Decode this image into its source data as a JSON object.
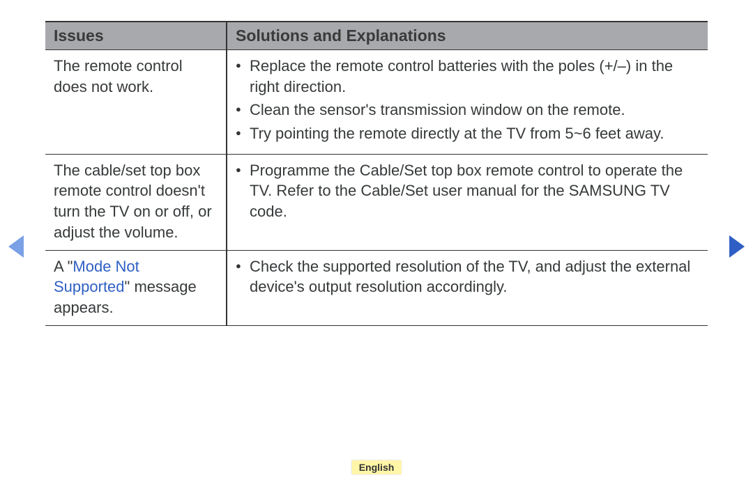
{
  "headers": {
    "issues": "Issues",
    "solutions": "Solutions and Explanations"
  },
  "rows": [
    {
      "issue_parts": [
        {
          "text": "The remote control does not work."
        }
      ],
      "solutions": [
        "Replace the remote control batteries with the poles (+/–) in the right direction.",
        "Clean the sensor's transmission window on the remote.",
        "Try pointing the remote directly at the TV from 5~6 feet away."
      ]
    },
    {
      "issue_parts": [
        {
          "text": "The cable/set top box remote control doesn't turn the TV on or off, or adjust the volume."
        }
      ],
      "solutions": [
        "Programme the Cable/Set top box remote control to operate the TV. Refer to the Cable/Set user manual for the SAMSUNG TV code."
      ]
    },
    {
      "issue_parts": [
        {
          "text": "A \""
        },
        {
          "text": "Mode Not Supported",
          "highlight": true
        },
        {
          "text": "\" message appears."
        }
      ],
      "solutions": [
        "Check the supported resolution of the TV, and adjust the external device's output resolution accordingly."
      ]
    }
  ],
  "footer": {
    "language": "English"
  }
}
